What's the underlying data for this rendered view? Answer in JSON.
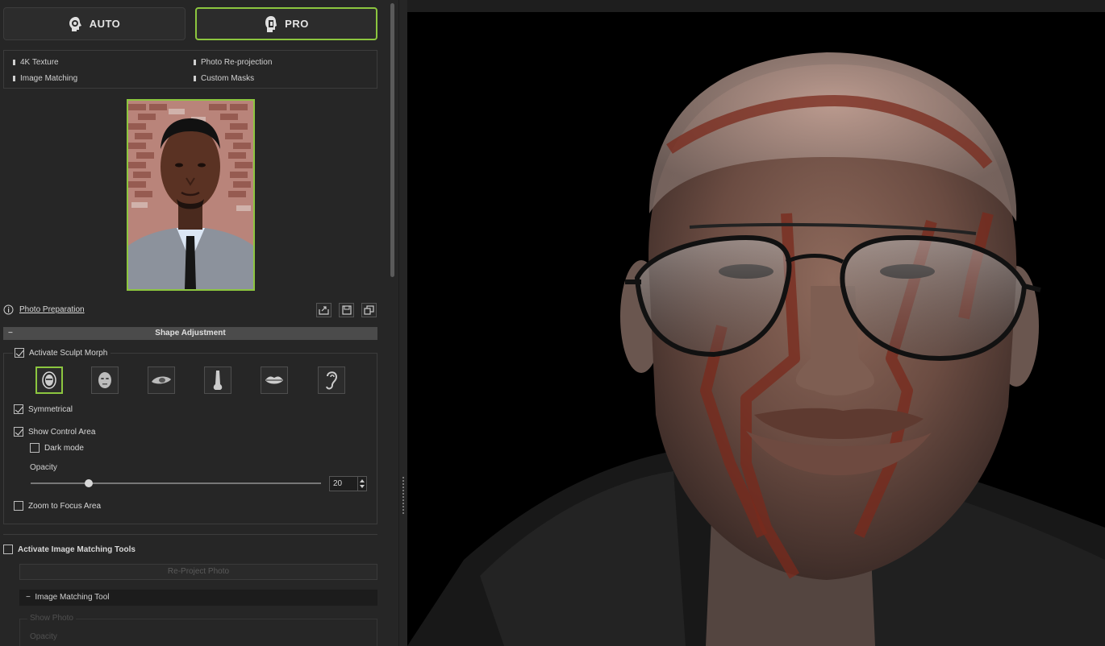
{
  "modes": {
    "auto_label": "AUTO",
    "pro_label": "PRO"
  },
  "features": [
    "4K Texture",
    "Photo Re-projection",
    "Image Matching",
    "Custom Masks"
  ],
  "photo_prep": {
    "label": "Photo Preparation"
  },
  "shape_adjustment": {
    "header": "Shape Adjustment",
    "activate_sculpt_label": "Activate Sculpt Morph",
    "parts": [
      "face-front-icon",
      "head-icon",
      "eye-icon",
      "nose-icon",
      "lips-icon",
      "ear-icon"
    ],
    "symmetrical_label": "Symmetrical",
    "show_control_label": "Show Control Area",
    "dark_mode_label": "Dark mode",
    "opacity_label": "Opacity",
    "opacity_value": "20",
    "zoom_label": "Zoom to Focus Area"
  },
  "image_matching": {
    "activate_label": "Activate Image Matching Tools",
    "reproject_label": "Re-Project Photo",
    "tool_header": "Image Matching Tool",
    "show_photo_label": "Show Photo",
    "opacity_label": "Opacity"
  },
  "colors": {
    "accent": "#8cc63f",
    "panel": "#262626",
    "viewport": "#000000"
  }
}
